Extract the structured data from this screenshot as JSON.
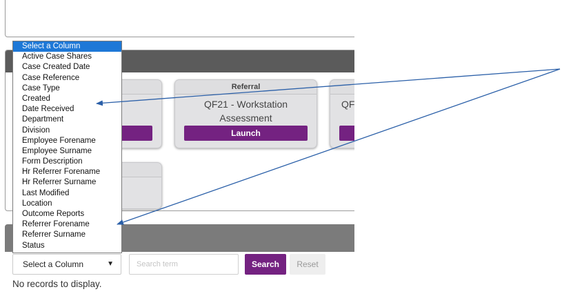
{
  "cards": [
    {
      "title": "",
      "body": "",
      "button": "Launch"
    },
    {
      "title": "Referral",
      "body_line1": "QF21 - Workstation",
      "body_line2": "Assessment",
      "button": "Launch"
    },
    {
      "title": "",
      "body": "QF",
      "button": ""
    },
    {
      "title": "",
      "body": "",
      "button": ""
    }
  ],
  "dropdown": {
    "options": [
      "Select a Column",
      "Active Case Shares",
      "Case Created Date",
      "Case Reference",
      "Case Type",
      "Created",
      "Date Received",
      "Department",
      "Division",
      "Employee Forename",
      "Employee Surname",
      "Form Description",
      "Hr Referrer Forename",
      "Hr Referrer Surname",
      "Last Modified",
      "Location",
      "Outcome Reports",
      "Referrer Forename",
      "Referrer Surname",
      "Status"
    ],
    "selected_index": 0
  },
  "filter": {
    "select_value": "Select a Column",
    "search_placeholder": "Search term",
    "search_label": "Search",
    "reset_label": "Reset"
  },
  "empty_message": "No records to display.",
  "colors": {
    "accent_purple": "#742281",
    "annotation_blue": "#2a5fa8",
    "selection_blue": "#1e78d7"
  }
}
